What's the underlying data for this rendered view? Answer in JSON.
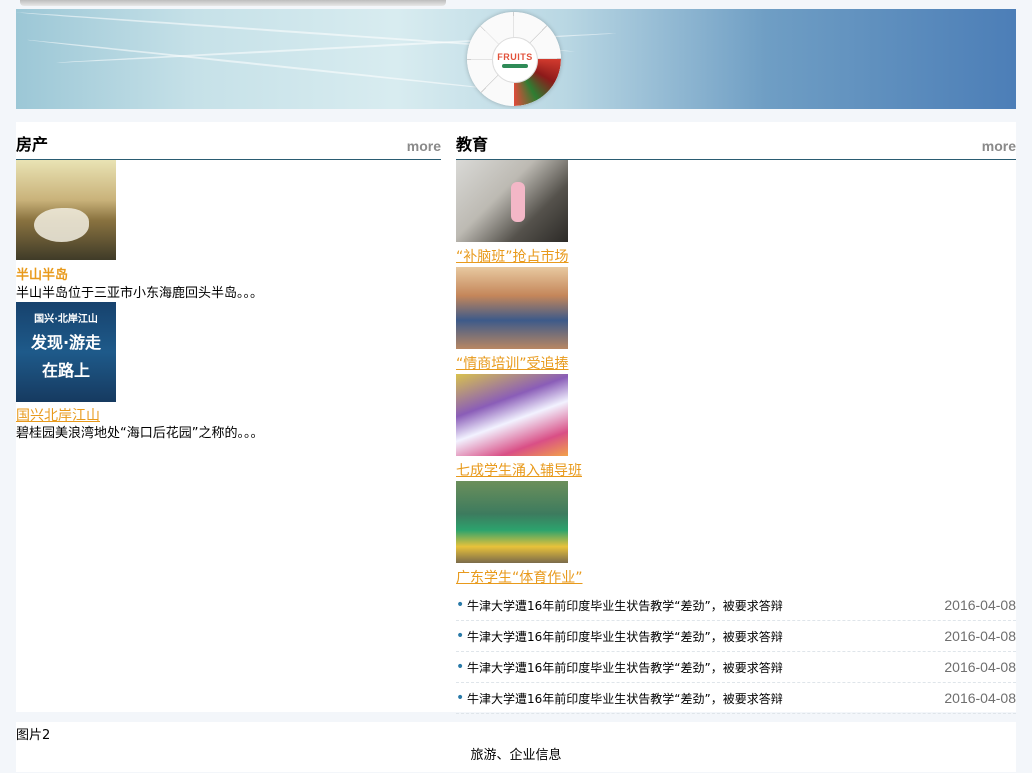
{
  "banner": {
    "logo_text": "FRUITS",
    "logo_icon": "fruits-logo-icon"
  },
  "sections": {
    "realestate": {
      "title": "房产",
      "more": "more",
      "items": [
        {
          "title": "半山半岛",
          "desc": "半山半岛位于三亚市小东海鹿回头半岛。。。",
          "thumb_name": "realestate-thumb-banshan"
        },
        {
          "title": "国兴北岸江山",
          "desc": "碧桂园美浪湾地处“海口后花园”之称的。。。",
          "thumb_name": "realestate-thumb-guoxing",
          "thumb_text": [
            "国兴·北岸江山",
            "发现·游走",
            "在路上"
          ]
        }
      ]
    },
    "education": {
      "title": "教育",
      "more": "more",
      "photos": [
        {
          "caption": "“补脑班”抢占市场"
        },
        {
          "caption": "“情商培训”受追捧"
        },
        {
          "caption": "七成学生涌入辅导班"
        },
        {
          "caption": "广东学生“体育作业”"
        }
      ],
      "news": [
        {
          "title": "牛津大学遭16年前印度毕业生状告教学“差劲”，被要求答辩",
          "date": "2016-04-08"
        },
        {
          "title": "牛津大学遭16年前印度毕业生状告教学“差劲”，被要求答辩",
          "date": "2016-04-08"
        },
        {
          "title": "牛津大学遭16年前印度毕业生状告教学“差劲”，被要求答辩",
          "date": "2016-04-08"
        },
        {
          "title": "牛津大学遭16年前印度毕业生状告教学“差劲”，被要求答辩",
          "date": "2016-04-08"
        }
      ]
    }
  },
  "footer": {
    "image_alt": "图片2",
    "links": "旅游、企业信息"
  }
}
